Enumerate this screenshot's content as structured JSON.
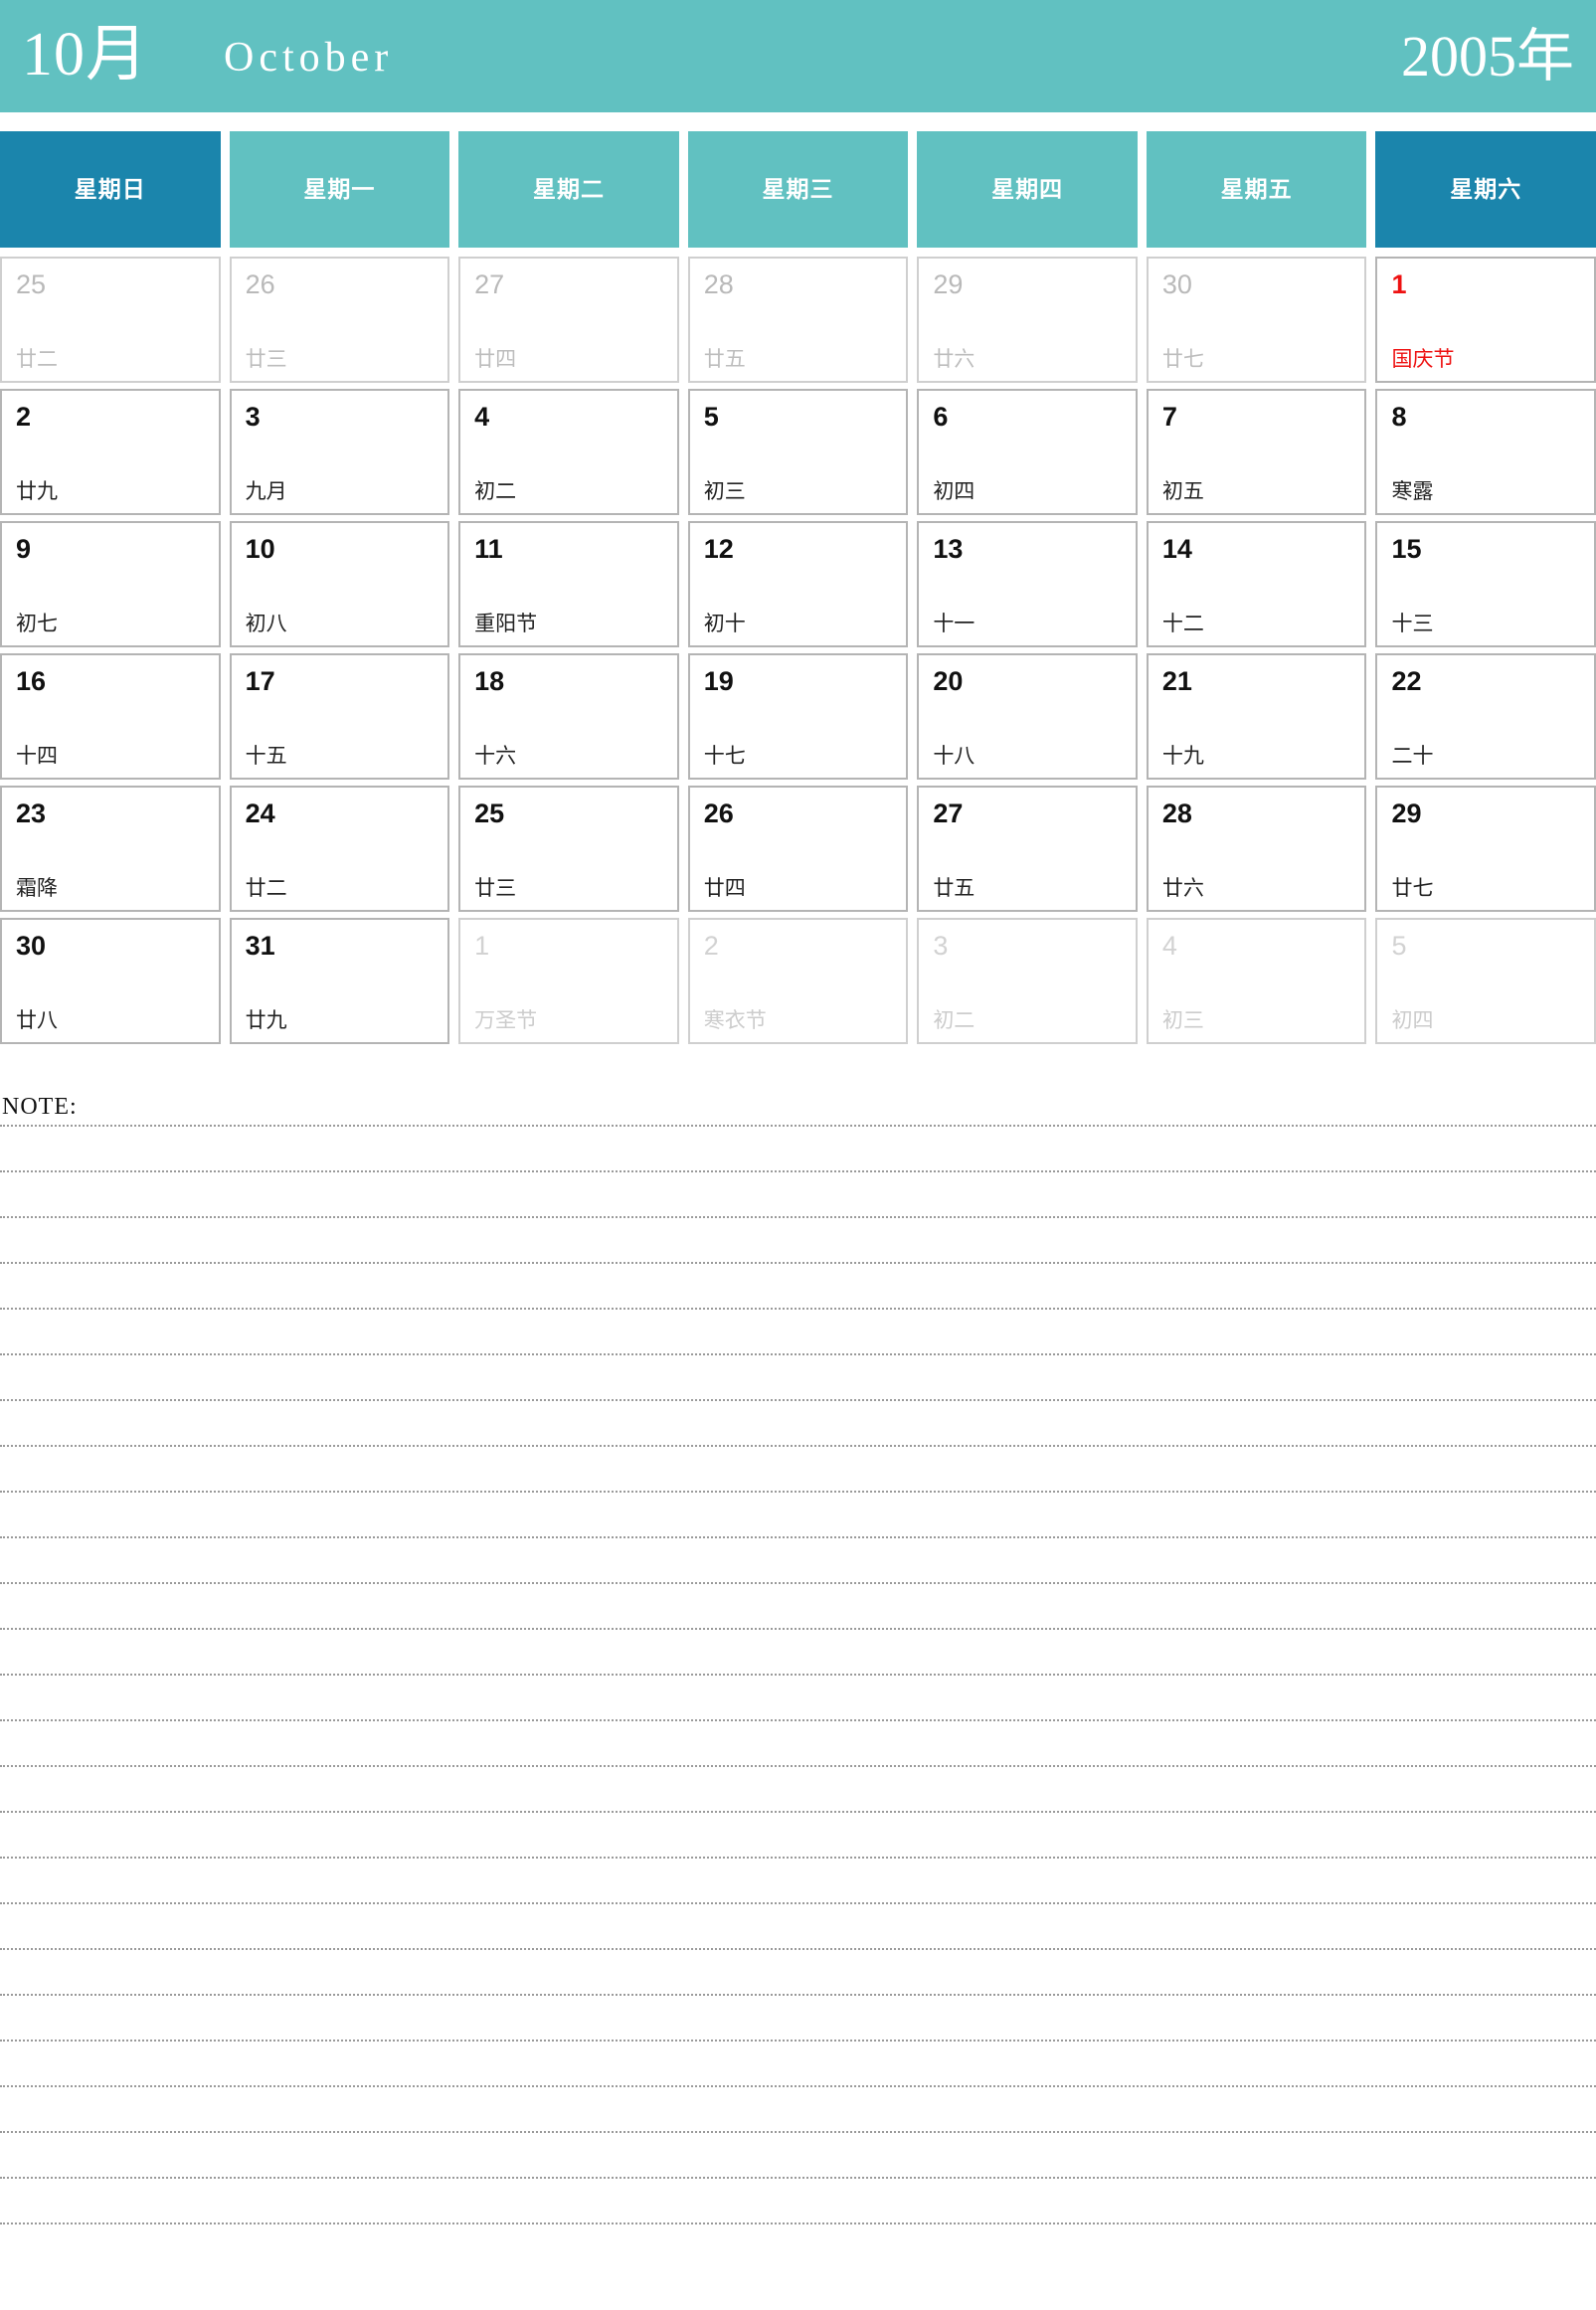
{
  "header": {
    "month_cn": "10月",
    "month_en": "October",
    "year": "2005年",
    "banner_color": "#61c1c1",
    "accent_color": "#1b85ac",
    "holiday_color": "#ee1111"
  },
  "weekdays": [
    {
      "label": "星期日",
      "weekend": true
    },
    {
      "label": "星期一",
      "weekend": false
    },
    {
      "label": "星期二",
      "weekend": false
    },
    {
      "label": "星期三",
      "weekend": false
    },
    {
      "label": "星期四",
      "weekend": false
    },
    {
      "label": "星期五",
      "weekend": false
    },
    {
      "label": "星期六",
      "weekend": true
    }
  ],
  "weeks": [
    [
      {
        "num": "25",
        "lunar": "廿二",
        "out": true
      },
      {
        "num": "26",
        "lunar": "廿三",
        "out": true
      },
      {
        "num": "27",
        "lunar": "廿四",
        "out": true
      },
      {
        "num": "28",
        "lunar": "廿五",
        "out": true
      },
      {
        "num": "29",
        "lunar": "廿六",
        "out": true
      },
      {
        "num": "30",
        "lunar": "廿七",
        "out": true
      },
      {
        "num": "1",
        "lunar": "国庆节",
        "out": false,
        "holiday": true
      }
    ],
    [
      {
        "num": "2",
        "lunar": "廿九",
        "out": false
      },
      {
        "num": "3",
        "lunar": "九月",
        "out": false
      },
      {
        "num": "4",
        "lunar": "初二",
        "out": false
      },
      {
        "num": "5",
        "lunar": "初三",
        "out": false
      },
      {
        "num": "6",
        "lunar": "初四",
        "out": false
      },
      {
        "num": "7",
        "lunar": "初五",
        "out": false
      },
      {
        "num": "8",
        "lunar": "寒露",
        "out": false
      }
    ],
    [
      {
        "num": "9",
        "lunar": "初七",
        "out": false
      },
      {
        "num": "10",
        "lunar": "初八",
        "out": false
      },
      {
        "num": "11",
        "lunar": "重阳节",
        "out": false
      },
      {
        "num": "12",
        "lunar": "初十",
        "out": false
      },
      {
        "num": "13",
        "lunar": "十一",
        "out": false
      },
      {
        "num": "14",
        "lunar": "十二",
        "out": false
      },
      {
        "num": "15",
        "lunar": "十三",
        "out": false
      }
    ],
    [
      {
        "num": "16",
        "lunar": "十四",
        "out": false
      },
      {
        "num": "17",
        "lunar": "十五",
        "out": false
      },
      {
        "num": "18",
        "lunar": "十六",
        "out": false
      },
      {
        "num": "19",
        "lunar": "十七",
        "out": false
      },
      {
        "num": "20",
        "lunar": "十八",
        "out": false
      },
      {
        "num": "21",
        "lunar": "十九",
        "out": false
      },
      {
        "num": "22",
        "lunar": "二十",
        "out": false
      }
    ],
    [
      {
        "num": "23",
        "lunar": "霜降",
        "out": false
      },
      {
        "num": "24",
        "lunar": "廿二",
        "out": false
      },
      {
        "num": "25",
        "lunar": "廿三",
        "out": false
      },
      {
        "num": "26",
        "lunar": "廿四",
        "out": false
      },
      {
        "num": "27",
        "lunar": "廿五",
        "out": false
      },
      {
        "num": "28",
        "lunar": "廿六",
        "out": false
      },
      {
        "num": "29",
        "lunar": "廿七",
        "out": false
      }
    ],
    [
      {
        "num": "30",
        "lunar": "廿八",
        "out": false
      },
      {
        "num": "31",
        "lunar": "廿九",
        "out": false
      },
      {
        "num": "1",
        "lunar": "万圣节",
        "out": true,
        "next": true
      },
      {
        "num": "2",
        "lunar": "寒衣节",
        "out": true,
        "next": true
      },
      {
        "num": "3",
        "lunar": "初二",
        "out": true,
        "next": true
      },
      {
        "num": "4",
        "lunar": "初三",
        "out": true,
        "next": true
      },
      {
        "num": "5",
        "lunar": "初四",
        "out": true,
        "next": true
      }
    ]
  ],
  "note": {
    "label": "NOTE:",
    "line_count": 25
  }
}
